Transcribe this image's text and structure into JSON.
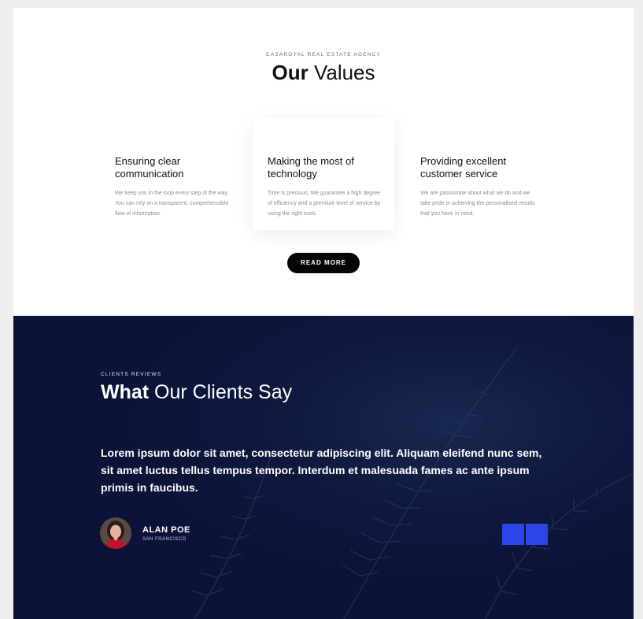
{
  "values": {
    "eyebrow": "CASAROYAL REAL ESTATE AGENCY",
    "title_bold": "Our",
    "title_rest": " Values",
    "cards": [
      {
        "heading": "Ensuring clear communication",
        "text": "We keep you in the loop every step of the way. You can rely on a transparent, comprehensible flow of information."
      },
      {
        "heading": "Making the most of technology",
        "text": "Time is precious. We guarantee a high degree of efficiency and a premium level of service by using the right tools."
      },
      {
        "heading": "Providing excellent customer service",
        "text": "We are passionate about what we do and we take pride in achieving the personalised results that you have in mind."
      }
    ],
    "button_label": "READ MORE"
  },
  "reviews": {
    "eyebrow": "CLIENTS REVIEWS",
    "title_bold": "What",
    "title_rest": " Our Clients Say",
    "quote": "Lorem ipsum dolor sit amet, consectetur adipiscing elit. Aliquam eleifend nunc sem, sit amet luctus tellus tempus tempor. Interdum et malesuada fames ac ante ipsum primis in faucibus.",
    "author_name": "ALAN POE",
    "author_location": "SAN FRANCISCO",
    "accent_color": "#2c45e6",
    "background_color": "#0b1338"
  }
}
